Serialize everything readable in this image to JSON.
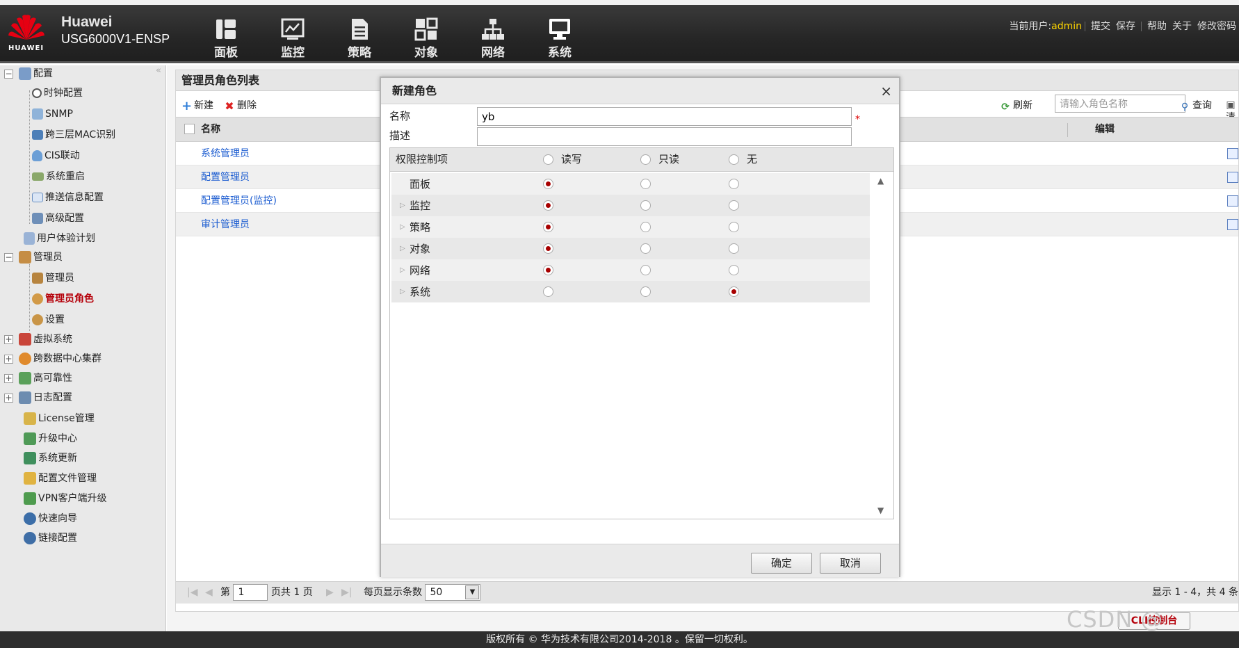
{
  "header": {
    "logo_text": "HUAWEI",
    "brand": "Huawei",
    "model": "USG6000V1-ENSP",
    "nav": [
      {
        "label": "面板",
        "icon": "dashboard-icon"
      },
      {
        "label": "监控",
        "icon": "monitor-icon"
      },
      {
        "label": "策略",
        "icon": "policy-icon"
      },
      {
        "label": "对象",
        "icon": "object-icon"
      },
      {
        "label": "网络",
        "icon": "network-icon"
      },
      {
        "label": "系统",
        "icon": "system-icon"
      }
    ],
    "current_user_label": "当前用户:",
    "current_user": "admin",
    "links": [
      "提交",
      "保存",
      "帮助",
      "关于",
      "修改密码"
    ]
  },
  "sidebar": {
    "collapse": "«",
    "items": [
      {
        "label": "配置",
        "expander": "−",
        "icon": "config-icon"
      },
      {
        "label": "时钟配置",
        "icon": "clock-icon"
      },
      {
        "label": "SNMP",
        "icon": "snmp-icon"
      },
      {
        "label": "跨三层MAC识别",
        "icon": "mac-icon"
      },
      {
        "label": "CIS联动",
        "icon": "cis-icon"
      },
      {
        "label": "系统重启",
        "icon": "restart-icon"
      },
      {
        "label": "推送信息配置",
        "icon": "push-icon"
      },
      {
        "label": "高级配置",
        "icon": "advanced-icon"
      },
      {
        "label": "用户体验计划",
        "icon": "experience-icon"
      },
      {
        "label": "管理员",
        "expander": "−",
        "icon": "admin-icon"
      },
      {
        "label": "管理员",
        "icon": "admin-user-icon"
      },
      {
        "label": "管理员角色",
        "icon": "admin-role-icon",
        "active": true
      },
      {
        "label": "设置",
        "icon": "settings-icon"
      },
      {
        "label": "虚拟系统",
        "expander": "+",
        "icon": "vsys-icon"
      },
      {
        "label": "跨数据中心集群",
        "expander": "+",
        "icon": "cluster-icon"
      },
      {
        "label": "高可靠性",
        "expander": "+",
        "icon": "ha-icon"
      },
      {
        "label": "日志配置",
        "expander": "+",
        "icon": "log-icon"
      },
      {
        "label": "License管理",
        "icon": "license-icon"
      },
      {
        "label": "升级中心",
        "icon": "upgrade-icon"
      },
      {
        "label": "系统更新",
        "icon": "update-icon"
      },
      {
        "label": "配置文件管理",
        "icon": "config-file-icon"
      },
      {
        "label": "VPN客户端升级",
        "icon": "vpn-icon"
      },
      {
        "label": "快速向导",
        "icon": "wizard-icon"
      },
      {
        "label": "链接配置",
        "icon": "link-icon"
      }
    ]
  },
  "panel": {
    "title": "管理员角色列表",
    "new_label": "新建",
    "delete_label": "删除",
    "refresh_label": "刷新",
    "search_placeholder": "请输入角色名称",
    "query_label": "查询",
    "clear_label": "清",
    "col_name": "名称",
    "col_edit": "编辑",
    "rows": [
      "系统管理员",
      "配置管理员",
      "配置管理员(监控)",
      "审计管理员"
    ],
    "pager": {
      "page_prefix": "第",
      "page": "1",
      "page_suffix": "页共 1 页",
      "per_page_label": "每页显示条数",
      "per_page": "50",
      "info": "显示 1 - 4，共 4 条"
    }
  },
  "modal": {
    "title": "新建角色",
    "close": "×",
    "name_label": "名称",
    "name_value": "yb",
    "required": "*",
    "desc_label": "描述",
    "desc_value": "",
    "grid_header": {
      "item": "权限控制项",
      "rw": "读写",
      "ro": "只读",
      "none": "无"
    },
    "rows": [
      {
        "name": "面板",
        "selected": "rw",
        "expandable": false
      },
      {
        "name": "监控",
        "selected": "rw",
        "expandable": true
      },
      {
        "name": "策略",
        "selected": "rw",
        "expandable": true
      },
      {
        "name": "对象",
        "selected": "rw",
        "expandable": true
      },
      {
        "name": "网络",
        "selected": "rw",
        "expandable": true
      },
      {
        "name": "系统",
        "selected": "none",
        "expandable": true
      }
    ],
    "ok": "确定",
    "cancel": "取消"
  },
  "cli_label": "CLI控制台",
  "footer": "版权所有 © 华为技术有限公司2014-2018 。保留一切权利。",
  "watermark": "CSDN @",
  "colors": {
    "accent": "#b5000a",
    "link": "#1a5bd0",
    "user": "#ffd600"
  }
}
